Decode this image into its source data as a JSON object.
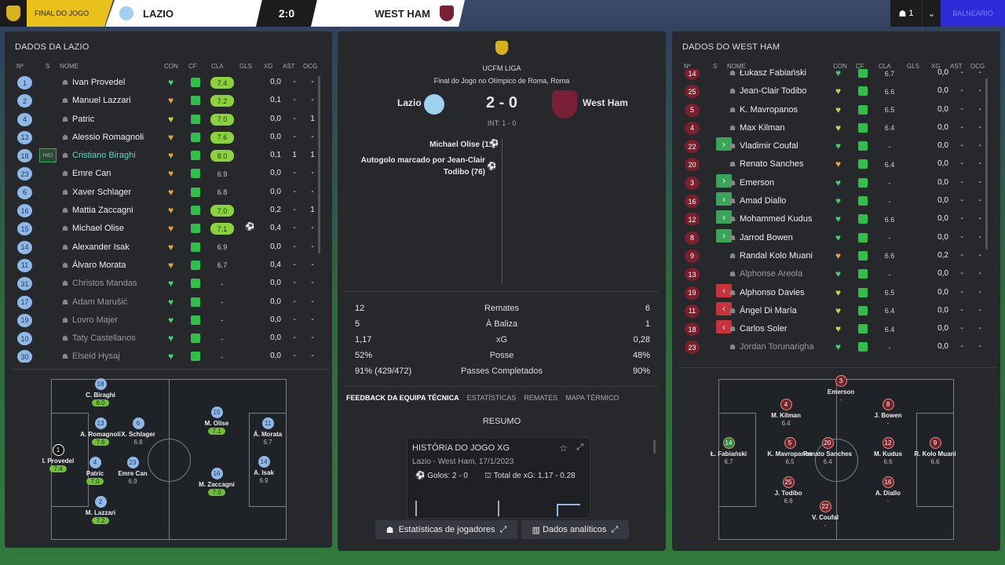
{
  "topbar": {
    "final_label": "FINAL DO JOGO",
    "home_team": "LAZIO",
    "score": "2:0",
    "away_team": "WEST HAM",
    "people_count": "1",
    "right_label": "BALNEARIO"
  },
  "columns": {
    "no": "Nº",
    "s": "S",
    "name": "NOME",
    "con": "CON",
    "cf": "CF",
    "cla": "CLA",
    "gls": "GLS",
    "xg": "XG",
    "ast": "AST",
    "ocg": "OCG"
  },
  "left": {
    "title": "DADOS DA LAZIO",
    "players": [
      {
        "num": "1",
        "name": "Ivan Provedel",
        "con": "g",
        "cla": "7.4",
        "hi": true,
        "xg": "0,0",
        "ast": "-",
        "ocg": "-"
      },
      {
        "num": "2",
        "name": "Manuel Lazzari",
        "con": "o",
        "cla": "7.2",
        "hi": true,
        "xg": "0,1",
        "ast": "-",
        "ocg": "-"
      },
      {
        "num": "4",
        "name": "Patric",
        "con": "y",
        "cla": "7.0",
        "hi": true,
        "xg": "0,0",
        "ast": "-",
        "ocg": "1"
      },
      {
        "num": "13",
        "name": "Alessio Romagnoli",
        "con": "o",
        "cla": "7.6",
        "hi": true,
        "xg": "0,0",
        "ast": "-",
        "ocg": "-"
      },
      {
        "num": "18",
        "name": "Cristiano Biraghi",
        "con": "o",
        "cla": "8.0",
        "hi": true,
        "xg": "0,1",
        "ast": "1",
        "ocg": "1",
        "sel": true,
        "s": "HdJ"
      },
      {
        "num": "23",
        "name": "Emre Can",
        "con": "o",
        "cla": "6.9",
        "xg": "0,0",
        "ast": "-",
        "ocg": "-"
      },
      {
        "num": "6",
        "name": "Xaver Schlager",
        "con": "o",
        "cla": "6.8",
        "xg": "0,0",
        "ast": "-",
        "ocg": "-"
      },
      {
        "num": "16",
        "name": "Mattia Zaccagni",
        "con": "o",
        "cla": "7.0",
        "hi": true,
        "xg": "0,2",
        "ast": "-",
        "ocg": "1"
      },
      {
        "num": "15",
        "name": "Michael Olise",
        "con": "o",
        "cla": "7.1",
        "hi": true,
        "ev": "⚽",
        "xg": "0,4",
        "ast": "-",
        "ocg": "-"
      },
      {
        "num": "14",
        "name": "Alexander Isak",
        "con": "o",
        "cla": "6.9",
        "xg": "0,0",
        "ast": "-",
        "ocg": "-"
      },
      {
        "num": "11",
        "name": "Álvaro Morata",
        "con": "o",
        "cla": "6.7",
        "xg": "0,4",
        "ast": "-",
        "ocg": "-"
      },
      {
        "num": "31",
        "name": "Christos Mandas",
        "con": "g",
        "cla": "-",
        "xg": "0,0",
        "ast": "-",
        "ocg": "-",
        "dim": true
      },
      {
        "num": "17",
        "name": "Adam Marušić",
        "con": "g",
        "cla": "-",
        "xg": "0,0",
        "ast": "-",
        "ocg": "-",
        "dim": true
      },
      {
        "num": "19",
        "name": "Lovro Majer",
        "con": "g",
        "cla": "-",
        "xg": "0,0",
        "ast": "-",
        "ocg": "-",
        "dim": true
      },
      {
        "num": "10",
        "name": "Taty Castellanos",
        "con": "g",
        "cla": "-",
        "xg": "0,0",
        "ast": "-",
        "ocg": "-",
        "dim": true
      },
      {
        "num": "30",
        "name": "Elseid Hysaj",
        "con": "g",
        "cla": "-",
        "xg": "0,0",
        "ast": "-",
        "ocg": "-",
        "dim": true
      }
    ],
    "formation": [
      {
        "num": "1",
        "name": "I. Provedel",
        "rating": "7.4",
        "g": true,
        "gk": true
      },
      {
        "num": "18",
        "name": "C. Biraghi",
        "rating": "8.0",
        "g": true
      },
      {
        "num": "13",
        "name": "A. Romagnoli",
        "rating": "7.6",
        "g": true
      },
      {
        "num": "4",
        "name": "Patric",
        "rating": "7.0",
        "g": true
      },
      {
        "num": "2",
        "name": "M. Lazzari",
        "rating": "7.2",
        "g": true
      },
      {
        "num": "6",
        "name": "X. Schlager",
        "rating": "6.8"
      },
      {
        "num": "23",
        "name": "Emre Can",
        "rating": "6.9"
      },
      {
        "num": "15",
        "name": "M. Olise",
        "rating": "7.1",
        "g": true
      },
      {
        "num": "16",
        "name": "M. Zaccagni",
        "rating": "7.0",
        "g": true
      },
      {
        "num": "11",
        "name": "Á. Morata",
        "rating": "6.7"
      },
      {
        "num": "14",
        "name": "A. Isak",
        "rating": "6.9"
      }
    ]
  },
  "match": {
    "competition": "UCFM LIGA",
    "subtitle": "Final do Jogo no Olímpico de Roma, Roma",
    "home": "Lazio",
    "away": "West Ham",
    "score": "2 - 0",
    "halftime": "INT: 1 - 0",
    "event1": "Michael Olise (11)",
    "event2a": "Autogolo marcado por Jean-Clair",
    "event2b": "Todibo (76)",
    "stats": [
      {
        "home": "12",
        "label": "Remates",
        "away": "6"
      },
      {
        "home": "5",
        "label": "À Baliza",
        "away": "1"
      },
      {
        "home": "1,17",
        "label": "xG",
        "away": "0,28"
      },
      {
        "home": "52%",
        "label": "Posse",
        "away": "48%"
      },
      {
        "home": "91% (429/472)",
        "label": "Passes Completados",
        "away": "90%"
      }
    ],
    "tabs": [
      "FEEDBACK DA EQUIPA TÉCNICA",
      "ESTATÍSTICAS",
      "REMATES",
      "MAPA TÉRMICO"
    ],
    "summary_label": "RESUMO",
    "card_title": "HISTÓRIA DO JOGO XG",
    "card_sub": "Lazio - West Ham, 17/1/2023",
    "card_goals": "Golos: 2 - 0",
    "card_xg": "Total de xG: 1.17 - 0.28",
    "btn_players": "Estatísticas de jogadores",
    "btn_analytics": "Dados analíticos"
  },
  "right": {
    "title": "DADOS DO WEST HAM",
    "players": [
      {
        "num": "14",
        "name": "Łukasz Fabiański",
        "con": "g",
        "cf": "g",
        "cla": "6.7",
        "xg": "0,0",
        "ast": "-",
        "ocg": "-"
      },
      {
        "num": "25",
        "name": "Jean-Clair Todibo",
        "con": "y",
        "cf": "g",
        "cla": "6.6",
        "xg": "0,0",
        "ast": "-",
        "ocg": "-"
      },
      {
        "num": "5",
        "name": "K. Mavropanos",
        "con": "y",
        "cf": "g",
        "cla": "6.5",
        "xg": "0,0",
        "ast": "-",
        "ocg": "-"
      },
      {
        "num": "4",
        "name": "Max Kilman",
        "con": "y",
        "cf": "g",
        "cla": "6.4",
        "xg": "0,0",
        "ast": "-",
        "ocg": "-"
      },
      {
        "num": "22",
        "name": "Vladimir Coufal",
        "con": "g",
        "cf": "g",
        "cla": "-",
        "xg": "0,0",
        "ast": "-",
        "ocg": "-",
        "sub": "in"
      },
      {
        "num": "20",
        "name": "Renato Sanches",
        "con": "o",
        "cf": "g",
        "cla": "6.4",
        "xg": "0,0",
        "ast": "-",
        "ocg": "-"
      },
      {
        "num": "3",
        "name": "Emerson",
        "con": "g",
        "cf": "g",
        "cla": "-",
        "xg": "0,0",
        "ast": "-",
        "ocg": "-",
        "sub": "in"
      },
      {
        "num": "16",
        "name": "Amad Diallo",
        "con": "g",
        "cf": "g",
        "cla": "-",
        "xg": "0,0",
        "ast": "-",
        "ocg": "-",
        "sub": "in"
      },
      {
        "num": "12",
        "name": "Mohammed Kudus",
        "con": "g",
        "cf": "g",
        "cla": "6.6",
        "xg": "0,0",
        "ast": "-",
        "ocg": "-",
        "sub": "in"
      },
      {
        "num": "8",
        "name": "Jarrod Bowen",
        "con": "g",
        "cf": "g",
        "cla": "-",
        "xg": "0,0",
        "ast": "-",
        "ocg": "-",
        "sub": "in"
      },
      {
        "num": "9",
        "name": "Randal Kolo Muani",
        "con": "o",
        "cf": "g",
        "cla": "6.6",
        "xg": "0,2",
        "ast": "-",
        "ocg": "-"
      },
      {
        "num": "13",
        "name": "Alphonse Areola",
        "con": "g",
        "cf": "g",
        "cla": "-",
        "xg": "0,0",
        "ast": "-",
        "ocg": "-",
        "dim": true
      },
      {
        "num": "19",
        "name": "Alphonso Davies",
        "con": "y",
        "cf": "g",
        "cla": "6.5",
        "xg": "0,0",
        "ast": "-",
        "ocg": "-",
        "sub": "out"
      },
      {
        "num": "11",
        "name": "Ángel Di María",
        "con": "y",
        "cf": "g",
        "cla": "6.4",
        "xg": "0,0",
        "ast": "-",
        "ocg": "-",
        "sub": "out"
      },
      {
        "num": "18",
        "name": "Carlos Soler",
        "con": "y",
        "cf": "g",
        "cla": "6.4",
        "xg": "0,0",
        "ast": "-",
        "ocg": "-",
        "sub": "out"
      },
      {
        "num": "23",
        "name": "Jordan Torunarigha",
        "con": "g",
        "cf": "g",
        "cla": "-",
        "xg": "0,0",
        "ast": "-",
        "ocg": "-",
        "dim": true
      }
    ],
    "formation": [
      {
        "num": "3",
        "name": "Emerson",
        "rating": "-"
      },
      {
        "num": "4",
        "name": "M. Kilman",
        "rating": "6.4"
      },
      {
        "num": "8",
        "name": "J. Bowen",
        "rating": "-"
      },
      {
        "num": "14",
        "name": "Ł. Fabiański",
        "rating": "6.7",
        "gk": true
      },
      {
        "num": "5",
        "name": "K. Mavropanos",
        "rating": "6.5"
      },
      {
        "num": "20",
        "name": "Renato Sanches",
        "rating": "6.4"
      },
      {
        "num": "12",
        "name": "M. Kudus",
        "rating": "6.6"
      },
      {
        "num": "9",
        "name": "R. Kolo Muani",
        "rating": "6.6"
      },
      {
        "num": "25",
        "name": "J. Todibo",
        "rating": "6.6"
      },
      {
        "num": "16",
        "name": "A. Diallo",
        "rating": "-"
      },
      {
        "num": "22",
        "name": "V. Coufal",
        "rating": "-"
      }
    ]
  }
}
